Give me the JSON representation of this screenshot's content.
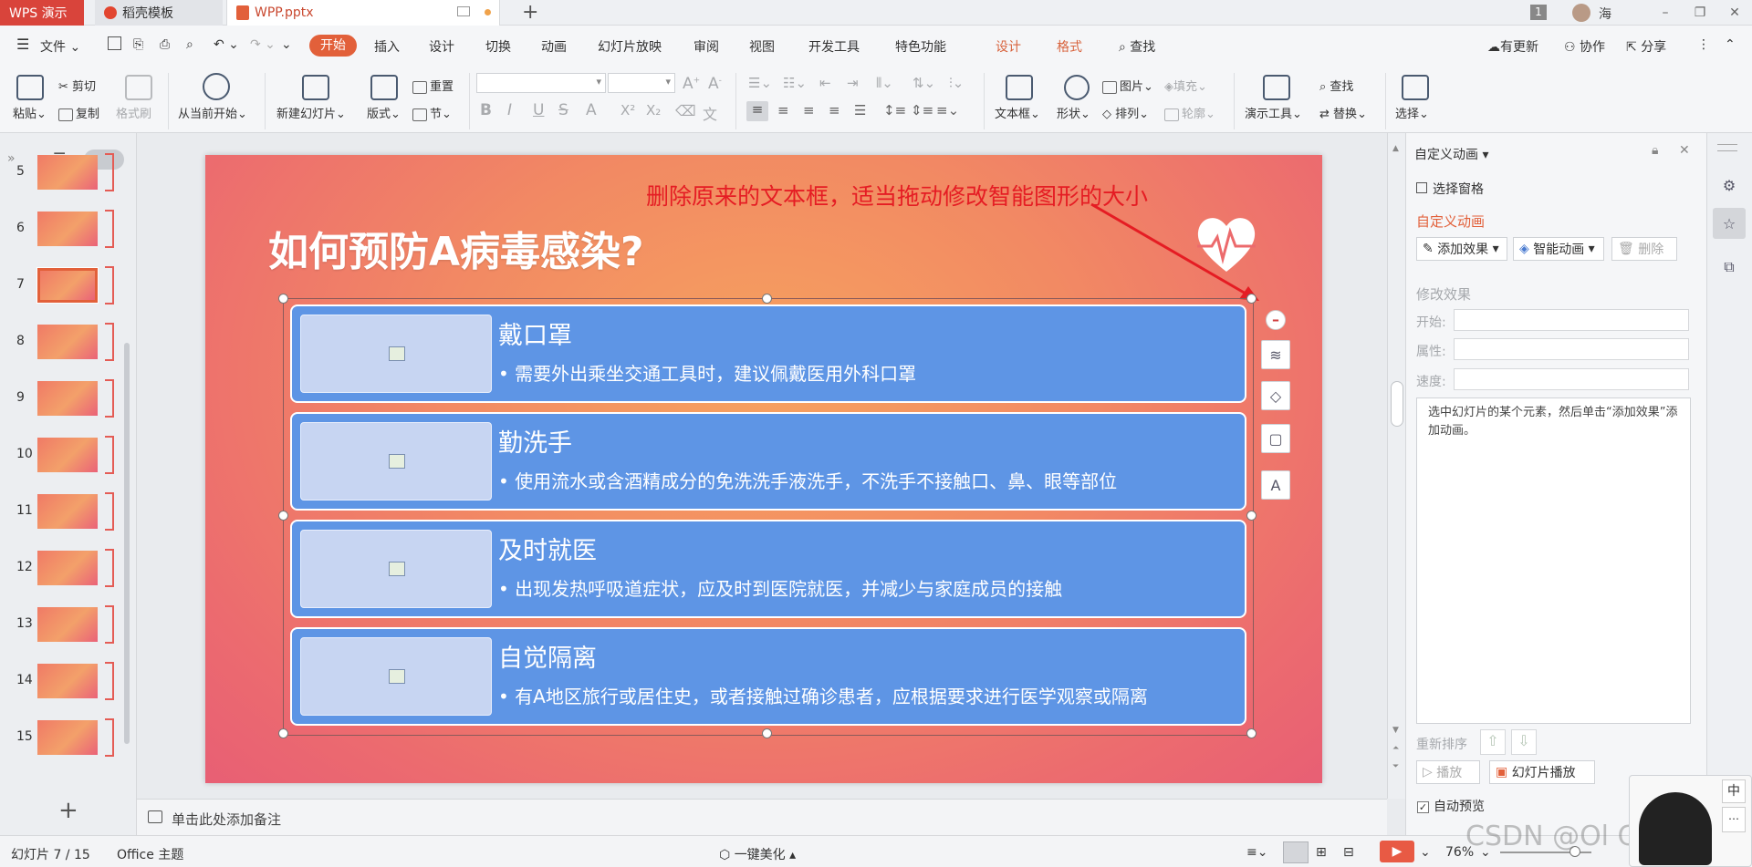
{
  "tabs": {
    "app": "WPS 演示",
    "template": "稻壳模板",
    "file": "WPP.pptx",
    "page_badge": "1",
    "user": "海"
  },
  "menu": {
    "file": "文件",
    "items": [
      "开始",
      "插入",
      "设计",
      "切换",
      "动画",
      "幻灯片放映",
      "审阅",
      "视图",
      "开发工具",
      "特色功能"
    ],
    "context_items": [
      "设计",
      "格式"
    ],
    "search": "查找",
    "update": "有更新",
    "collab": "协作",
    "share": "分享"
  },
  "ribbon": {
    "paste": "粘贴",
    "cut": "剪切",
    "copy": "复制",
    "format_painter": "格式刷",
    "from_current": "从当前开始",
    "new_slide": "新建幻灯片",
    "layout": "版式",
    "reset": "重置",
    "section": "节",
    "text_box": "文本框",
    "shape": "形状",
    "picture": "图片",
    "fill": "填充",
    "arrange": "排列",
    "outline": "轮廓",
    "presenter_tools": "演示工具",
    "find": "查找",
    "replace": "替换",
    "select": "选择",
    "font_buttons": [
      "B",
      "I",
      "U",
      "S",
      "A",
      "X²",
      "X₂",
      "文"
    ]
  },
  "thumbnails": [
    {
      "num": "5"
    },
    {
      "num": "6"
    },
    {
      "num": "7",
      "selected": true
    },
    {
      "num": "8"
    },
    {
      "num": "9"
    },
    {
      "num": "10"
    },
    {
      "num": "11"
    },
    {
      "num": "12"
    },
    {
      "num": "13"
    },
    {
      "num": "14"
    },
    {
      "num": "15"
    }
  ],
  "slide": {
    "annotation": "删除原来的文本框，适当拖动修改智能图形的大小",
    "title": "如何预防A病毒感染?",
    "cards": [
      {
        "title": "戴口罩",
        "desc": "需要外出乘坐交通工具时，建议佩戴医用外科口罩"
      },
      {
        "title": "勤洗手",
        "desc": "使用流水或含酒精成分的免洗洗手液洗手，不洗手不接触口、鼻、眼等部位"
      },
      {
        "title": "及时就医",
        "desc": "出现发热呼吸道症状，应及时到医院就医，并减少与家庭成员的接触"
      },
      {
        "title": "自觉隔离",
        "desc": "有A地区旅行或居住史，或者接触过确诊患者，应根据要求进行医学观察或隔离"
      }
    ]
  },
  "notes_placeholder": "单击此处添加备注",
  "right_panel": {
    "header": "自定义动画",
    "selection_pane": "选择窗格",
    "section_title": "自定义动画",
    "add_effect": "添加效果",
    "smart_anim": "智能动画",
    "delete": "删除",
    "modify": "修改效果",
    "start": "开始:",
    "property": "属性:",
    "speed": "速度:",
    "hint": "选中幻灯片的某个元素，然后单击“添加效果”添加动画。",
    "reorder": "重新排序",
    "play": "播放",
    "slideshow": "幻灯片播放",
    "auto_preview": "自动预览"
  },
  "status": {
    "slide_count": "幻灯片 7 / 15",
    "theme": "Office 主题",
    "beautify": "一键美化",
    "zoom": "76%"
  },
  "watermark": "CSDN @Ol Correct",
  "ime": "中",
  "colors": {
    "accent": "#e2603a",
    "card": "#5e95e5",
    "annotation": "#e51c23"
  }
}
